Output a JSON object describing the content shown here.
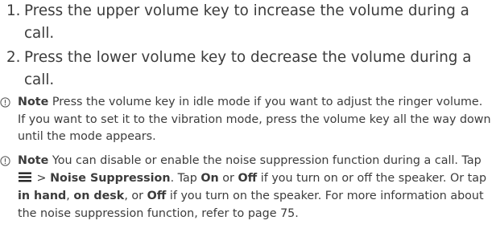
{
  "steps": [
    {
      "num": "1.",
      "text": "Press the upper volume key to increase the volume during a call."
    },
    {
      "num": "2.",
      "text": "Press the lower volume key to decrease the volume during a call."
    }
  ],
  "notes": [
    {
      "icon": "info-icon",
      "label": "Note",
      "text": " Press the volume key in idle mode if you want to adjust the ringer volume. If you want to set it to the vibration mode, press the volume key all the way down until the mode appears."
    },
    {
      "icon": "info-icon",
      "label": "Note",
      "t1": " You can disable or enable the noise suppression function during a call. Tap ",
      "menu_icon": "menu-icon",
      "t2": " > ",
      "b1": "Noise Suppression",
      "t3": ". Tap ",
      "b2": "On",
      "t4": " or ",
      "b3": "Off",
      "t5": " if you turn on or off the speaker. Or tap ",
      "b4": "in hand",
      "t6": ", ",
      "b5": "on desk",
      "t7": ", or ",
      "b6": "Off",
      "t8": " if you turn on the speaker. For more information about the noise suppression function, refer to page 75."
    }
  ],
  "colors": {
    "text": "#3c3c3c",
    "icon": "#555555"
  }
}
